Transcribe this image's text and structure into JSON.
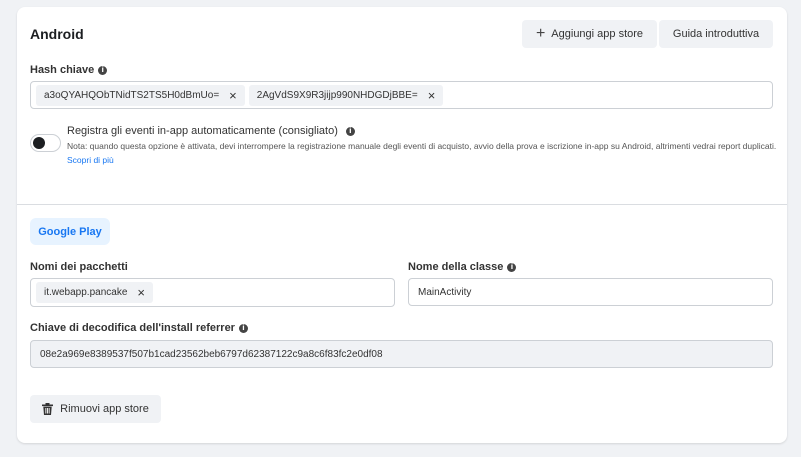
{
  "section": {
    "title": "Android",
    "add_app_store_label": "Aggiungi app store",
    "guide_label": "Guida introduttiva"
  },
  "hash": {
    "label": "Hash chiave",
    "keys": [
      "a3oQYAHQObTNidTS2TS5H0dBmUo=",
      "2AgVdS9X9R3jijp990NHDGDjBBE="
    ]
  },
  "events": {
    "toggle_on": false,
    "title": "Registra gli eventi in-app automaticamente (consigliato)",
    "note": "Nota: quando questa opzione è attivata, devi interrompere la registrazione manuale degli eventi di acquisto, avvio della prova e iscrizione in-app su Android, altrimenti vedrai report duplicati.",
    "link": "Scopri di più"
  },
  "store": {
    "tab_label": "Google Play",
    "packages_label": "Nomi dei pacchetti",
    "packages": [
      "it.webapp.pancake"
    ],
    "class_label": "Nome della classe",
    "class_value": "MainActivity",
    "referrer_label": "Chiave di decodifica dell'install referrer",
    "referrer_value": "08e2a969e8389537f507b1cad23562beb6797d62387122c9a8c6f83fc2e0df08",
    "remove_label": "Rimuovi app store"
  }
}
